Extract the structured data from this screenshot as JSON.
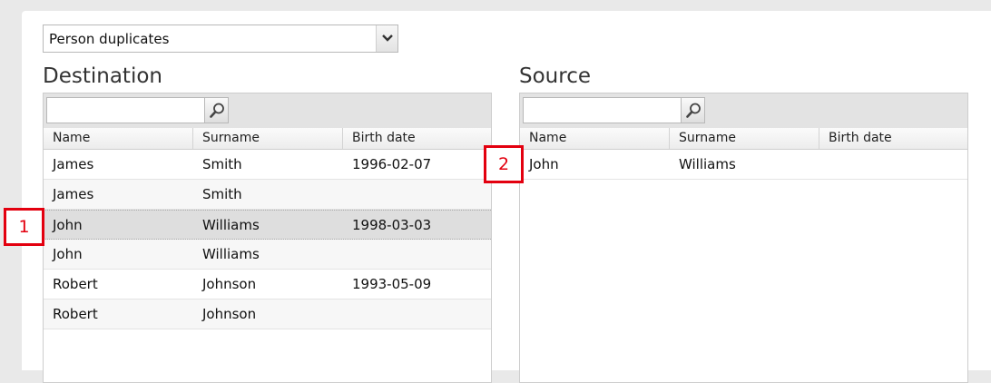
{
  "dropdown": {
    "selected": "Person duplicates",
    "icon": "chevron-down-icon"
  },
  "destination": {
    "title": "Destination",
    "search": {
      "value": "",
      "icon": "search-icon"
    },
    "columns": [
      "Name",
      "Surname",
      "Birth date"
    ],
    "rows": [
      [
        "James",
        "Smith",
        "1996-02-07"
      ],
      [
        "James",
        "Smith",
        ""
      ],
      [
        "John",
        "Williams",
        "1998-03-03"
      ],
      [
        "John",
        "Williams",
        ""
      ],
      [
        "Robert",
        "Johnson",
        "1993-05-09"
      ],
      [
        "Robert",
        "Johnson",
        ""
      ]
    ],
    "selected_row": 2
  },
  "source": {
    "title": "Source",
    "search": {
      "value": "",
      "icon": "search-icon"
    },
    "columns": [
      "Name",
      "Surname",
      "Birth date"
    ],
    "rows": [
      [
        "John",
        "Williams",
        ""
      ]
    ]
  },
  "markers": [
    "1",
    "2"
  ],
  "colors": {
    "marker": "#e3000f",
    "selected_row": "#dedede"
  }
}
